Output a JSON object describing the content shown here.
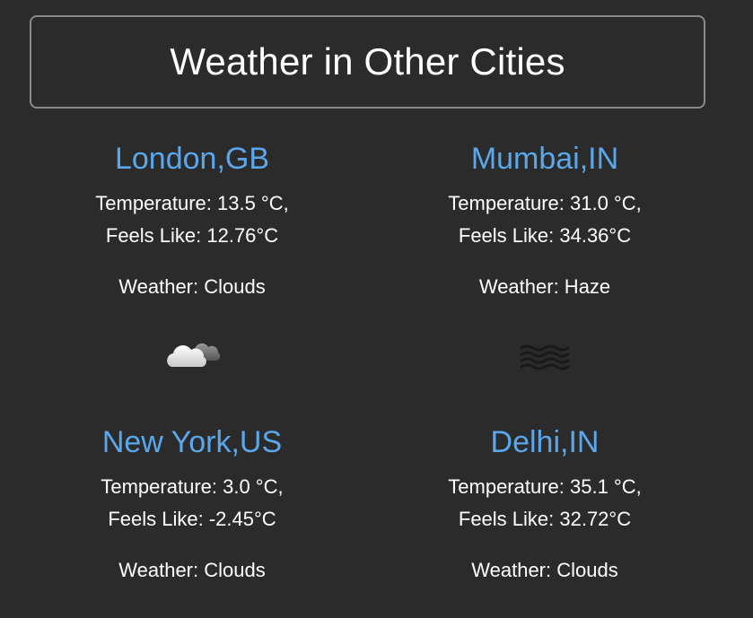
{
  "header": {
    "title": "Weather in Other Cities"
  },
  "colors": {
    "background": "#2b2b2b",
    "city_name": "#5aa7ec",
    "text": "#ffffff",
    "header_border": "#8a8a8a"
  },
  "cities": [
    {
      "name": "London,GB",
      "temperature": "Temperature: 13.5 °C,",
      "feels_like": "Feels Like: 12.76°C",
      "weather": "Weather: Clouds",
      "icon": "cloud-icon"
    },
    {
      "name": "Mumbai,IN",
      "temperature": "Temperature: 31.0 °C,",
      "feels_like": "Feels Like: 34.36°C",
      "weather": "Weather: Haze",
      "icon": "haze-icon"
    },
    {
      "name": "New York,US",
      "temperature": "Temperature: 3.0 °C,",
      "feels_like": "Feels Like: -2.45°C",
      "weather": "Weather: Clouds",
      "icon": "cloud-icon"
    },
    {
      "name": "Delhi,IN",
      "temperature": "Temperature: 35.1 °C,",
      "feels_like": "Feels Like: 32.72°C",
      "weather": "Weather: Clouds",
      "icon": "cloud-icon"
    }
  ]
}
